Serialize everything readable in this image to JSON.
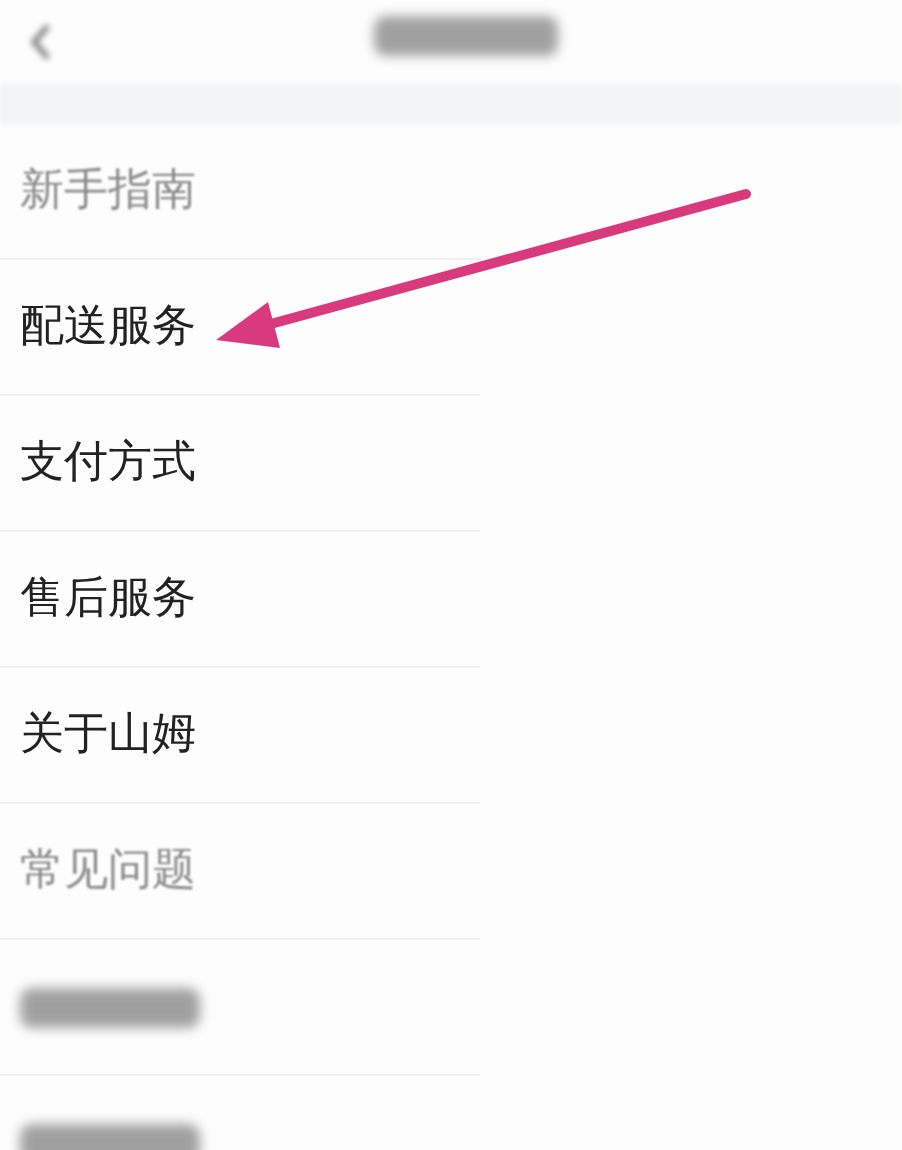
{
  "header": {
    "title": {
      "kind": "blurred"
    }
  },
  "items": [
    {
      "kind": "text",
      "label": "新手指南",
      "faded": true
    },
    {
      "kind": "text",
      "label": "配送服务",
      "faded": false
    },
    {
      "kind": "text",
      "label": "支付方式",
      "faded": false
    },
    {
      "kind": "text",
      "label": "售后服务",
      "faded": false
    },
    {
      "kind": "text",
      "label": "关于山姆",
      "faded": false
    },
    {
      "kind": "text",
      "label": "常见问题",
      "faded": true
    },
    {
      "kind": "blurred"
    },
    {
      "kind": "blurred"
    }
  ]
}
